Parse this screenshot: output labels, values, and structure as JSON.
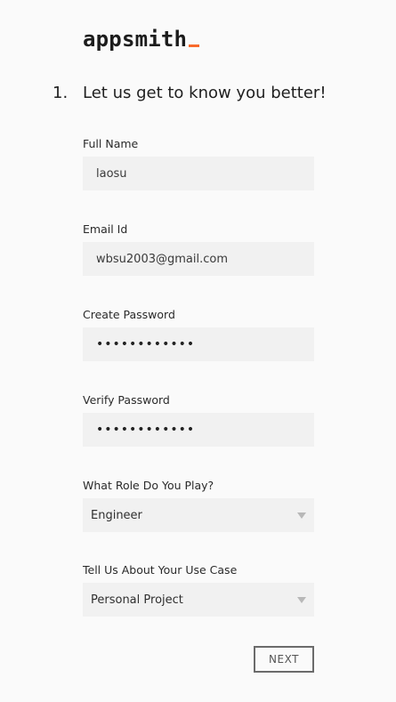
{
  "brand": {
    "name": "appsmith",
    "accent_color": "#f86a2b"
  },
  "step": {
    "number": "1.",
    "title": "Let us get to know you better!"
  },
  "form": {
    "full_name": {
      "label": "Full Name",
      "value": "laosu"
    },
    "email": {
      "label": "Email Id",
      "value": "wbsu2003@gmail.com"
    },
    "create_password": {
      "label": "Create Password",
      "value": "••••••••••••"
    },
    "verify_password": {
      "label": "Verify Password",
      "value": "••••••••••••"
    },
    "role": {
      "label": "What Role Do You Play?",
      "selected": "Engineer"
    },
    "use_case": {
      "label": "Tell Us About Your Use Case",
      "selected": "Personal Project"
    }
  },
  "actions": {
    "next_label": "NEXT"
  },
  "icons": {
    "dropdown": "caret-down-icon"
  }
}
